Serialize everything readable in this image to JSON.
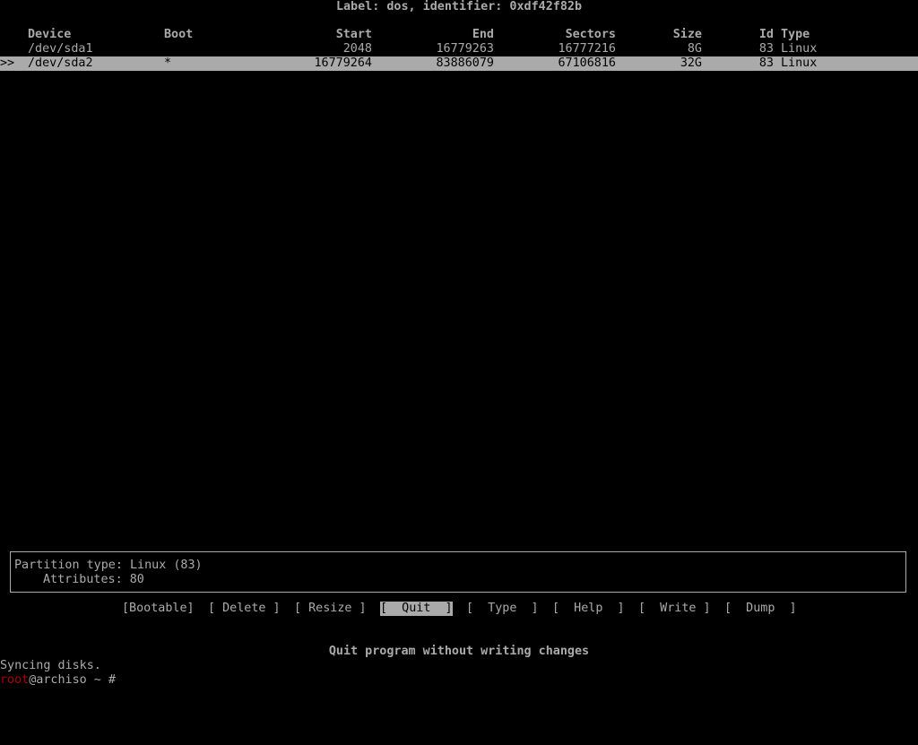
{
  "disk_label": "Label: dos, identifier: 0xdf42f82b",
  "table": {
    "headers": {
      "device": "Device",
      "boot": "Boot",
      "start": "Start",
      "end": "End",
      "sectors": "Sectors",
      "size": "Size",
      "id": "Id",
      "type": "Type"
    },
    "rows": [
      {
        "marker": "",
        "device": "/dev/sda1",
        "boot": "",
        "start": "2048",
        "end": "16779263",
        "sectors": "16777216",
        "size": "8G",
        "id": "83",
        "type": "Linux",
        "selected": false
      },
      {
        "marker": ">>",
        "device": "/dev/sda2",
        "boot": "*",
        "start": "16779264",
        "end": "83886079",
        "sectors": "67106816",
        "size": "32G",
        "id": "83",
        "type": "Linux",
        "selected": true
      }
    ]
  },
  "info": {
    "partition_type_label": "Partition type:",
    "partition_type_value": "Linux (83)",
    "attributes_label": "Attributes:",
    "attributes_value": "80"
  },
  "menu": {
    "bootable": "[Bootable]",
    "delete": "[ Delete ]",
    "resize": "[ Resize ]",
    "quit": "[  Quit  ]",
    "type": "[  Type  ]",
    "help": "[  Help  ]",
    "write": "[  Write ]",
    "dump": "[  Dump  ]",
    "active": "quit"
  },
  "hint": "Quit program without writing changes",
  "terminal": {
    "sync_message": "Syncing disks.",
    "prompt_user": "root",
    "prompt_rest": "@archiso ~ #"
  },
  "colors": {
    "background": "#000000",
    "text": "#aaaaaa",
    "selection": "#aaaaaa",
    "prompt_user": "#aa0000"
  }
}
